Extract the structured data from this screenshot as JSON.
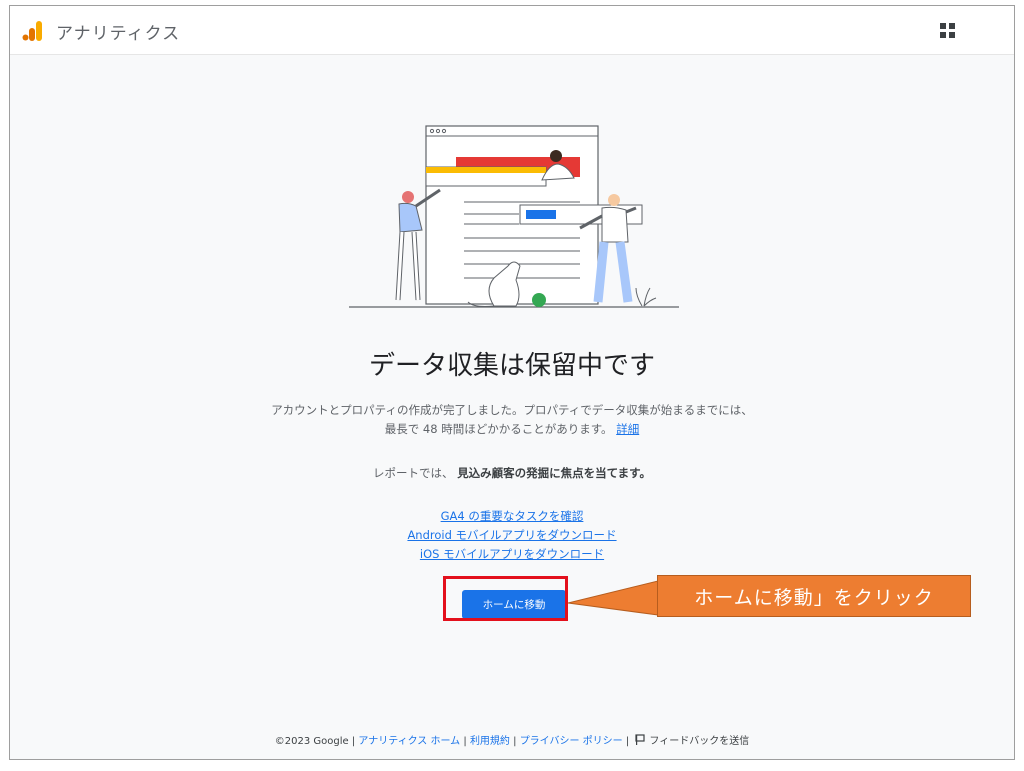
{
  "app": {
    "title": "アナリティクス",
    "logo_icon": "analytics-bars-icon",
    "apps_icon": "apps-grid-icon"
  },
  "main": {
    "headline": "データ収集は保留中です",
    "description_line1": "アカウントとプロパティの作成が完了しました。プロパティでデータ収集が始まるまでには、",
    "description_line2": "最長で 48 時間ほどかかることがあります。",
    "details_link": "詳細",
    "report_prefix": "レポートでは、",
    "report_bold": "見込み顧客の発掘に焦点を当てます。",
    "links": [
      "GA4 の重要なタスクを確認",
      "Android モバイルアプリをダウンロード",
      "iOS モバイルアプリをダウンロード"
    ],
    "home_button": "ホームに移動"
  },
  "annotation": {
    "callout_text": "ホームに移動」をクリック"
  },
  "footer": {
    "copyright": "©2023 Google",
    "sep": "|",
    "analytics_home": "アナリティクス ホーム",
    "terms": "利用規約",
    "privacy": "プライバシー ポリシー",
    "feedback": "フィードバックを送信",
    "feedback_icon": "feedback-flag-icon"
  },
  "colors": {
    "accent": "#1a73e8",
    "highlight": "#e3101c",
    "callout": "#ed7d31"
  }
}
